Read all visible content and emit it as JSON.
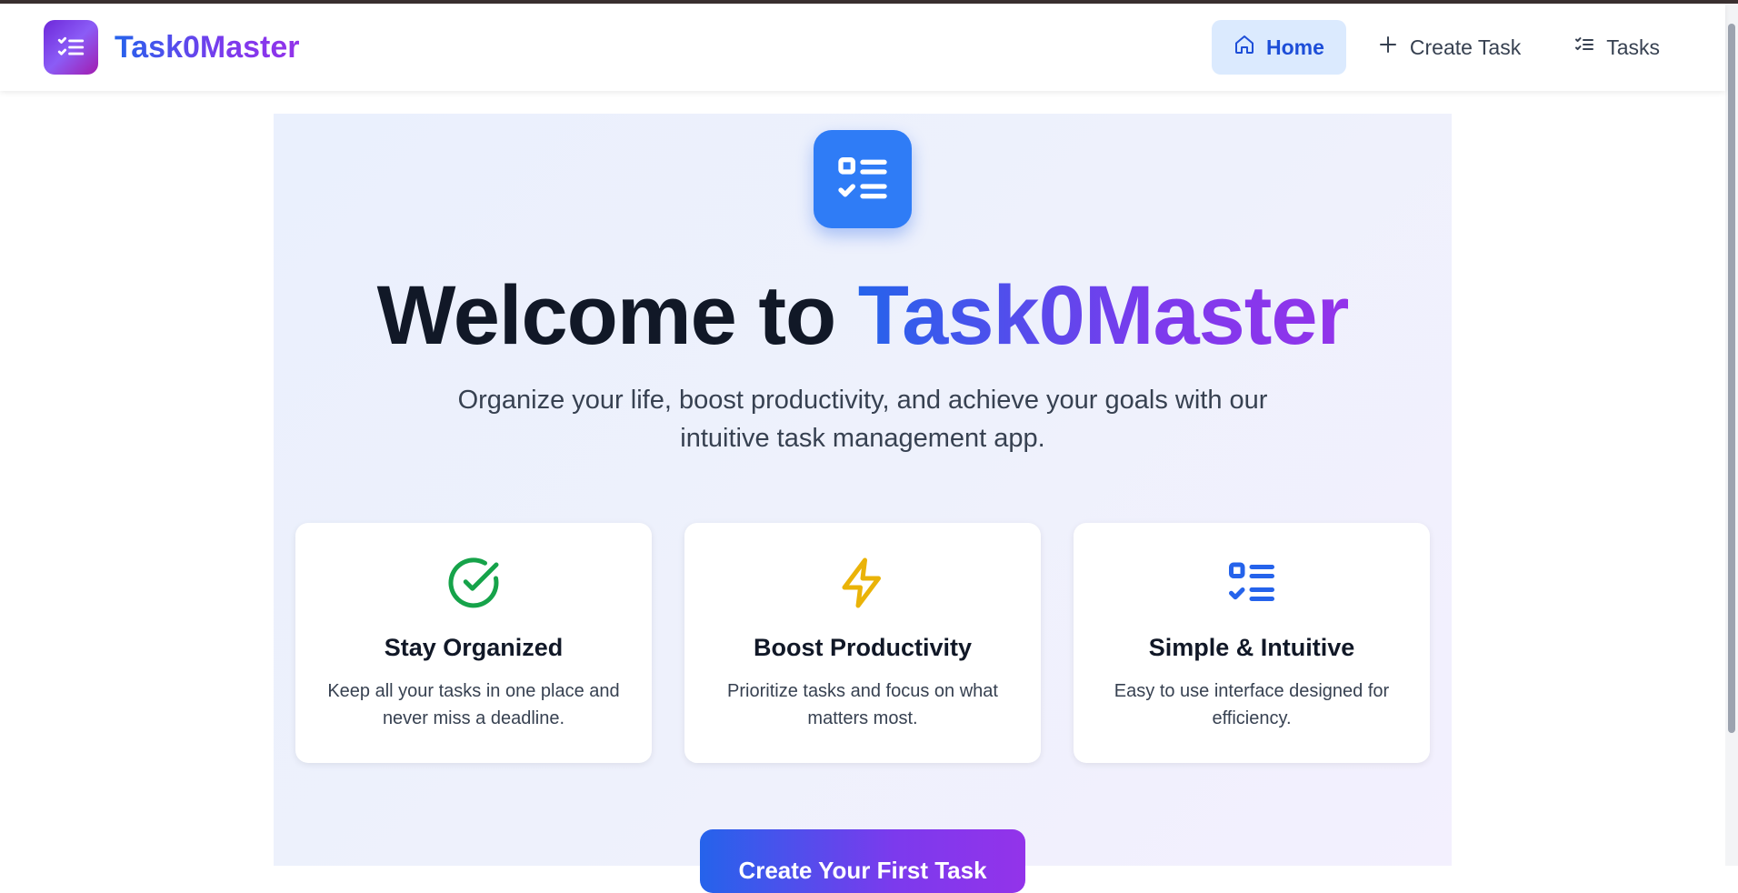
{
  "colors": {
    "brand_gradient_start": "#2563eb",
    "brand_gradient_end": "#9333ea",
    "active_nav_bg": "#dbeafe",
    "hero_icon_bg": "#2f7cf6",
    "check_icon": "#16a34a",
    "bolt_icon": "#eab308",
    "list_icon": "#2563eb"
  },
  "header": {
    "brand_name": "Task0Master",
    "brand_icon": "list-check-icon",
    "nav": [
      {
        "label": "Home",
        "icon": "home-icon",
        "active": true
      },
      {
        "label": "Create Task",
        "icon": "plus-icon",
        "active": false
      },
      {
        "label": "Tasks",
        "icon": "list-check-icon",
        "active": false
      }
    ]
  },
  "hero": {
    "icon": "list-check-icon",
    "title_prefix": "Welcome to ",
    "title_accent": "Task0Master",
    "subtitle": "Organize your life, boost productivity, and achieve your goals with our intuitive task management app."
  },
  "features": [
    {
      "icon": "check-circle-icon",
      "title": "Stay Organized",
      "description": "Keep all your tasks in one place and never miss a deadline."
    },
    {
      "icon": "lightning-bolt-icon",
      "title": "Boost Productivity",
      "description": "Prioritize tasks and focus on what matters most."
    },
    {
      "icon": "list-check-icon",
      "title": "Simple & Intuitive",
      "description": "Easy to use interface designed for efficiency."
    }
  ],
  "cta": {
    "label": "Create Your First Task"
  }
}
